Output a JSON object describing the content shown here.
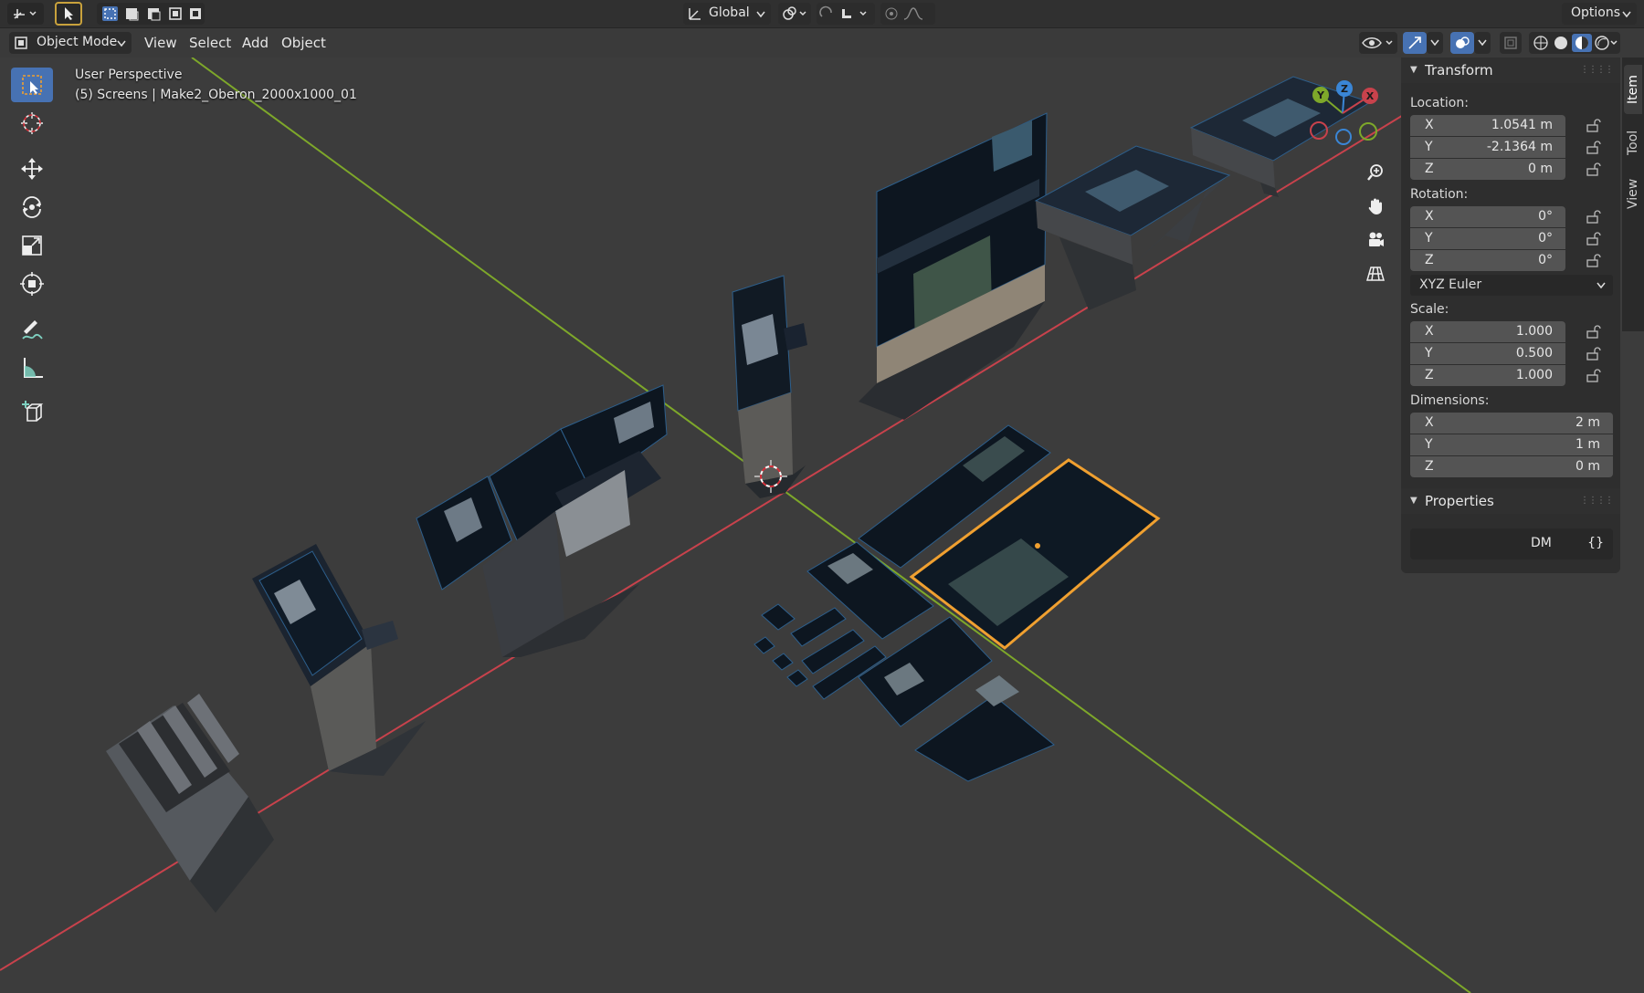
{
  "header": {
    "transform_orientation": "Global",
    "options_label": "Options"
  },
  "menubar": {
    "mode": "Object Mode",
    "items": [
      "View",
      "Select",
      "Add",
      "Object"
    ]
  },
  "viewport": {
    "perspective_label": "User Perspective",
    "object_label": "(5) Screens | Make2_Oberon_2000x1000_01",
    "gizmo": {
      "x": "X",
      "y": "Y",
      "z": "Z"
    }
  },
  "tools": [
    "select-box-icon",
    "cursor-icon",
    "move-icon",
    "rotate-icon",
    "scale-icon",
    "transform-icon",
    "annotate-icon",
    "measure-icon",
    "add-cube-icon"
  ],
  "sidebar": {
    "tabs": [
      "Item",
      "Tool",
      "View"
    ],
    "transform": {
      "title": "Transform",
      "location_label": "Location:",
      "location": [
        {
          "axis": "X",
          "value": "1.0541 m"
        },
        {
          "axis": "Y",
          "value": "-2.1364 m"
        },
        {
          "axis": "Z",
          "value": "0 m"
        }
      ],
      "rotation_label": "Rotation:",
      "rotation": [
        {
          "axis": "X",
          "value": "0°"
        },
        {
          "axis": "Y",
          "value": "0°"
        },
        {
          "axis": "Z",
          "value": "0°"
        }
      ],
      "rotation_mode": "XYZ Euler",
      "scale_label": "Scale:",
      "scale": [
        {
          "axis": "X",
          "value": "1.000"
        },
        {
          "axis": "Y",
          "value": "0.500"
        },
        {
          "axis": "Z",
          "value": "1.000"
        }
      ],
      "dimensions_label": "Dimensions:",
      "dimensions": [
        {
          "axis": "X",
          "value": "2 m"
        },
        {
          "axis": "Y",
          "value": "1 m"
        },
        {
          "axis": "Z",
          "value": "0 m"
        }
      ]
    },
    "properties": {
      "title": "Properties",
      "prop_name": "DM",
      "prop_value": "{}"
    }
  },
  "colors": {
    "x_axis": "#c8424c",
    "y_axis": "#7ea82a",
    "z_axis": "#3a86d6",
    "selection": "#f0a030",
    "accent": "#4772b3"
  }
}
